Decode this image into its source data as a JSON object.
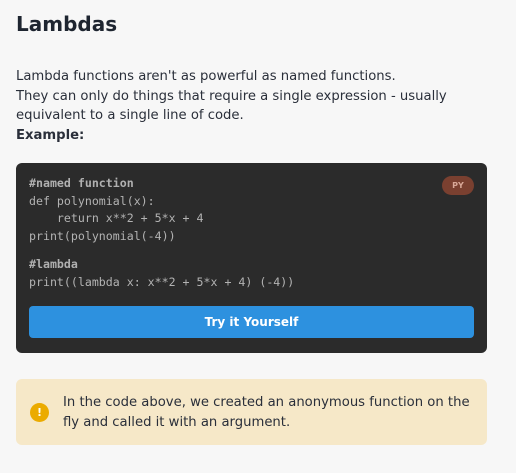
{
  "title": "Lambdas",
  "intro": {
    "line1": "Lambda functions aren't as powerful as named functions.",
    "line2": "They can only do things that require a single expression - usually equivalent to a single line of code.",
    "example_label": "Example:"
  },
  "code": {
    "badge": "PY",
    "comment1": "#named function",
    "lines1": "def polynomial(x):\n    return x**2 + 5*x + 4\nprint(polynomial(-4))",
    "comment2": "#lambda",
    "lines2": "print((lambda x: x**2 + 5*x + 4) (-4))",
    "button": "Try it Yourself"
  },
  "note": {
    "icon": "!",
    "text": "In the code above, we created an anonymous function on the fly and called it with an argument."
  }
}
